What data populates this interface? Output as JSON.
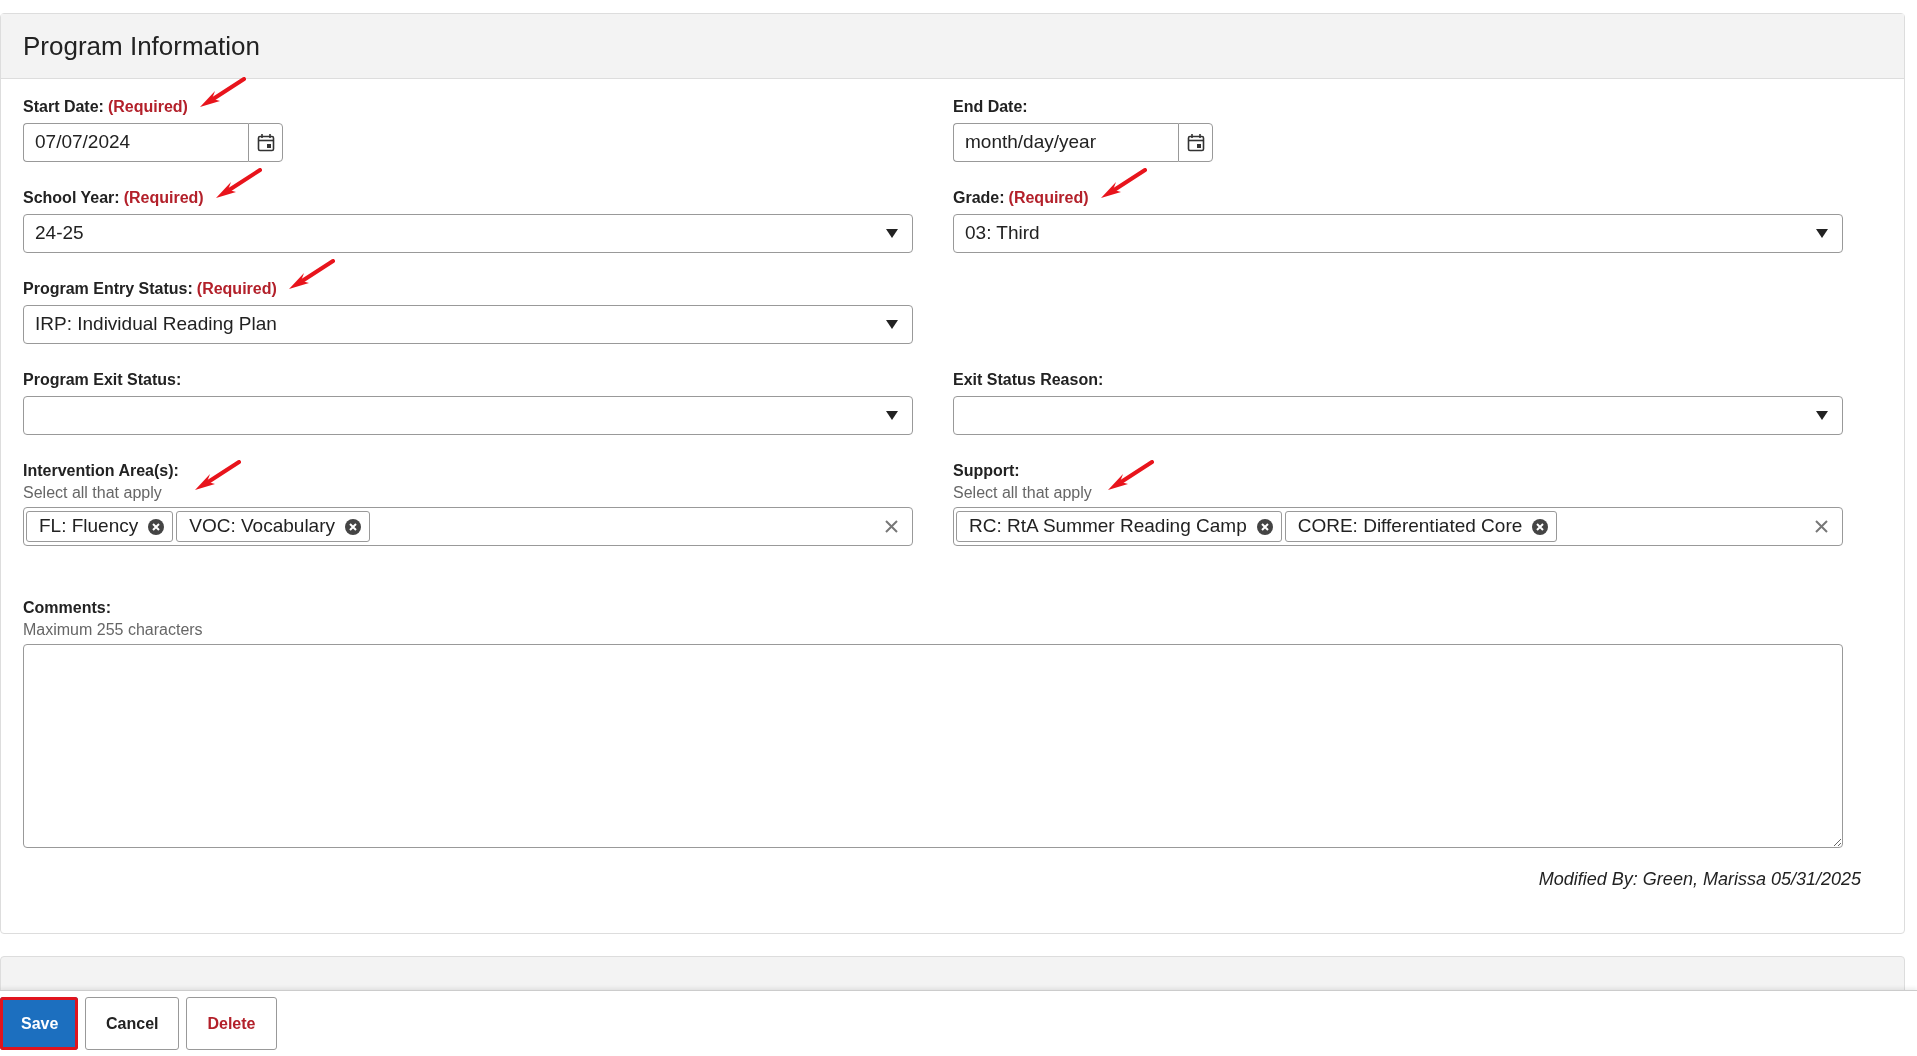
{
  "section": {
    "title": "Program Information"
  },
  "rows": [
    [
      {
        "kind": "date",
        "label": "Start Date:",
        "required": "(Required)",
        "annotated": true,
        "value": "07/07/2024"
      },
      {
        "kind": "date",
        "label": "End Date:",
        "annotated": false,
        "placeholder": "month/day/year"
      }
    ],
    [
      {
        "kind": "select",
        "label": "School Year:",
        "required": "(Required)",
        "annotated": true,
        "value": "24-25"
      },
      {
        "kind": "select",
        "label": "Grade:",
        "required": "(Required)",
        "annotated": true,
        "value": "03: Third"
      }
    ],
    [
      {
        "kind": "select",
        "label": "Program Entry Status:",
        "required": "(Required)",
        "annotated": true,
        "value": "IRP: Individual Reading Plan"
      }
    ],
    [
      {
        "kind": "select",
        "label": "Program Exit Status:",
        "annotated": false
      },
      {
        "kind": "select",
        "label": "Exit Status Reason:",
        "annotated": false
      }
    ],
    [
      {
        "kind": "multiselect",
        "label": "Intervention Area(s):",
        "hint": "Select all that apply",
        "annotated": true,
        "tags": [
          "FL: Fluency",
          "VOC: Vocabulary"
        ]
      },
      {
        "kind": "multiselect",
        "label": "Support:",
        "hint": "Select all that apply",
        "annotated": true,
        "tags": [
          "RC: RtA Summer Reading Camp",
          "CORE: Differentiated Core"
        ]
      }
    ]
  ],
  "comments": {
    "label": "Comments:",
    "hint": "Maximum 255 characters"
  },
  "modified": "Modified By: Green, Marissa 05/31/2025",
  "footer": {
    "buttons": [
      {
        "kind": "primary",
        "label": "Save",
        "highlighted": true
      },
      {
        "kind": "plain",
        "label": "Cancel",
        "highlighted": false
      },
      {
        "kind": "danger",
        "label": "Delete",
        "highlighted": false
      }
    ]
  }
}
